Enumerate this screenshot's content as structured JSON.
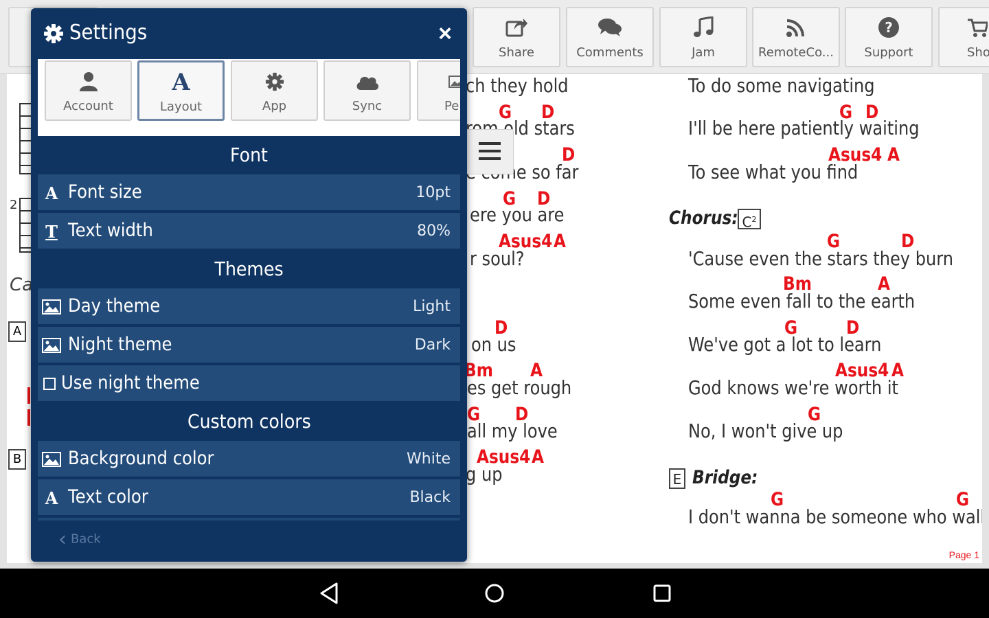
{
  "toolbar": {
    "buttons": [
      {
        "label": "Share",
        "icon": "share-icon"
      },
      {
        "label": "Comments",
        "icon": "comments-icon"
      },
      {
        "label": "Jam",
        "icon": "music-note-icon"
      },
      {
        "label": "RemoteCo...",
        "icon": "rss-icon"
      },
      {
        "label": "Support",
        "icon": "question-icon"
      },
      {
        "label": "Sho",
        "icon": "cart-icon"
      }
    ]
  },
  "sheet": {
    "left_col": [
      {
        "lyric": "ch they hold",
        "chords": []
      },
      {
        "lyric": "rom old stars",
        "chords": [
          "G",
          "D"
        ]
      },
      {
        "lyric": "e come so far",
        "chords": [
          "D"
        ]
      },
      {
        "lyric": "ere you are",
        "chords": [
          "G",
          "D"
        ]
      },
      {
        "lyric": "r soul?",
        "chords": [
          "Asus4",
          "A"
        ]
      },
      {
        "lyric": "on us",
        "chords": [
          "D"
        ]
      },
      {
        "lyric": "es get rough",
        "chords": [
          "Bm",
          "A"
        ]
      },
      {
        "lyric": "all my love",
        "chords": [
          "G",
          "D"
        ]
      },
      {
        "lyric": "g up",
        "chords": [
          "Asus4",
          "A"
        ]
      }
    ],
    "right_col": [
      {
        "lyric": "To do some navigating",
        "chords": []
      },
      {
        "lyric": "I'll be here patiently waiting",
        "chords": [
          "G",
          "D"
        ]
      },
      {
        "lyric": "To see what you find",
        "chords": [
          "Asus4",
          "A"
        ]
      },
      {
        "lyric": "'Cause even the stars they burn",
        "chords": [
          "G",
          "D"
        ]
      },
      {
        "lyric": "Some even fall to the earth",
        "chords": [
          "Bm",
          "A"
        ]
      },
      {
        "lyric": "We've got a lot to learn",
        "chords": [
          "G",
          "D"
        ]
      },
      {
        "lyric": "God knows we're worth  it",
        "chords": [
          "Asus4",
          "A"
        ]
      },
      {
        "lyric": "No, I won't give up",
        "chords": [
          "G"
        ]
      },
      {
        "lyric": "I don't wanna be someone who walks",
        "chords": [
          "G",
          "G"
        ]
      }
    ],
    "chorus_label": "Chorus:",
    "chorus_box": "C",
    "chorus_sup": "2",
    "bridge_label": "Bridge:",
    "bridge_box": "E",
    "side_box_a": "A",
    "side_box_b": "B",
    "side_text": "Ca",
    "diagram_fret": "2",
    "page_label": "Page 1"
  },
  "settings": {
    "title": "Settings",
    "tabs": [
      {
        "label": "Account",
        "icon": "user-icon"
      },
      {
        "label": "Layout",
        "icon": "font-a-icon"
      },
      {
        "label": "App",
        "icon": "gear-icon"
      },
      {
        "label": "Sync",
        "icon": "cloud-icon"
      },
      {
        "label": "Pe",
        "icon": "image-icon"
      }
    ],
    "sections": {
      "font": "Font",
      "themes": "Themes",
      "custom_colors": "Custom colors"
    },
    "rows": {
      "font_size": {
        "label": "Font size",
        "value": "10pt"
      },
      "text_width": {
        "label": "Text width",
        "value": "80%"
      },
      "day_theme": {
        "label": "Day theme",
        "value": "Light"
      },
      "night_theme": {
        "label": "Night theme",
        "value": "Dark"
      },
      "use_night_theme": {
        "label": "Use night theme"
      },
      "background_color": {
        "label": "Background color",
        "value": "White"
      },
      "text_color": {
        "label": "Text color",
        "value": "Black"
      }
    },
    "back_label": "Back"
  },
  "colors": {
    "panel": "#0f3462",
    "row": "#234c7a",
    "chord": "#e8141b"
  }
}
